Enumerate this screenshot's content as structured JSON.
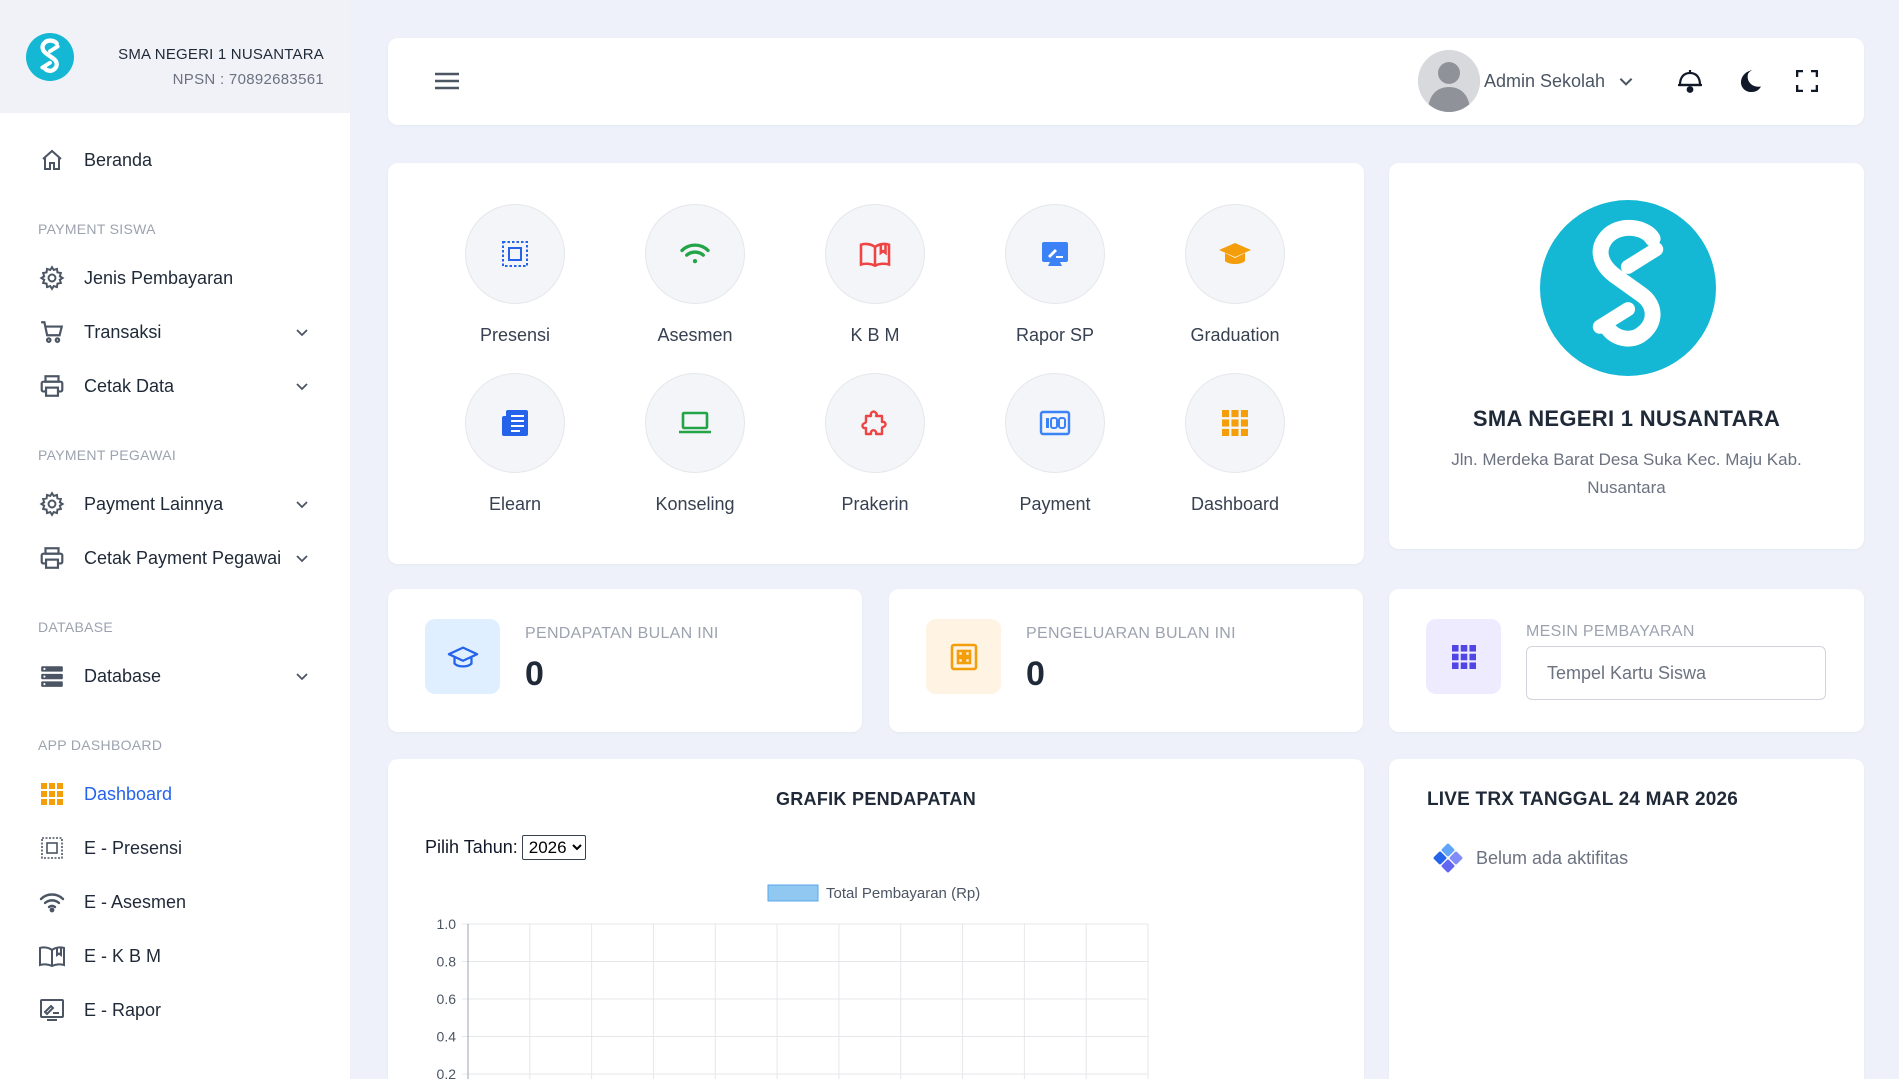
{
  "colors": {
    "accent": "#2563eb",
    "brand": "#14b8d4",
    "background": "#eef1f9",
    "orange": "#f59e0b",
    "green": "#22a447",
    "red": "#ef4444"
  },
  "sidebar": {
    "school_name": "SMA NEGERI 1 NUSANTARA",
    "npsn": "NPSN : 70892683561",
    "home": {
      "label": "Beranda",
      "icon": "home-icon"
    },
    "sections": {
      "payment_siswa": "PAYMENT SISWA",
      "payment_pegawai": "PAYMENT PEGAWAI",
      "database": "DATABASE",
      "app_dashboard": "APP DASHBOARD"
    },
    "items": {
      "jenis_pembayaran": {
        "label": "Jenis Pembayaran",
        "icon": "gear-icon"
      },
      "transaksi": {
        "label": "Transaksi",
        "icon": "cart-icon"
      },
      "cetak_data": {
        "label": "Cetak Data",
        "icon": "printer-icon"
      },
      "payment_lainnya": {
        "label": "Payment Lainnya",
        "icon": "gear-icon"
      },
      "cetak_payment_pegawai": {
        "label": "Cetak Payment Pegawai",
        "icon": "printer-icon"
      },
      "database": {
        "label": "Database",
        "icon": "server-icon"
      },
      "dashboard": {
        "label": "Dashboard",
        "icon": "grid-icon",
        "active": true
      },
      "e_presensi": {
        "label": "E - Presensi",
        "icon": "scan-icon"
      },
      "e_asesmen": {
        "label": "E - Asesmen",
        "icon": "wifi-icon"
      },
      "e_kbm": {
        "label": "E - K B M",
        "icon": "book-icon"
      },
      "e_rapor": {
        "label": "E - Rapor",
        "icon": "report-icon"
      }
    }
  },
  "topbar": {
    "user_name": "Admin Sekolah"
  },
  "apps": [
    {
      "label": "Presensi",
      "icon": "scan-icon"
    },
    {
      "label": "Asesmen",
      "icon": "wifi-icon"
    },
    {
      "label": "K B M",
      "icon": "book-icon"
    },
    {
      "label": "Rapor SP",
      "icon": "report-icon"
    },
    {
      "label": "Graduation",
      "icon": "graduation-cap-icon"
    },
    {
      "label": "Elearn",
      "icon": "newspaper-icon"
    },
    {
      "label": "Konseling",
      "icon": "laptop-icon"
    },
    {
      "label": "Prakerin",
      "icon": "puzzle-icon"
    },
    {
      "label": "Payment",
      "icon": "counter-icon"
    },
    {
      "label": "Dashboard",
      "icon": "grid-icon"
    }
  ],
  "school": {
    "name": "SMA NEGERI 1 NUSANTARA",
    "address": "Jln. Merdeka Barat Desa Suka Kec. Maju Kab. Nusantara"
  },
  "stats": {
    "pendapatan": {
      "label": "PENDAPATAN BULAN INI",
      "value": "0"
    },
    "pengeluaran": {
      "label": "PENGELUARAN BULAN INI",
      "value": "0"
    },
    "mesin": {
      "label": "MESIN PEMBAYARAN",
      "placeholder": "Tempel Kartu Siswa"
    }
  },
  "chart": {
    "title": "GRAFIK PENDAPATAN",
    "year_label": "Pilih Tahun:",
    "year_selected": "2026"
  },
  "chart_data": {
    "type": "bar",
    "title": "GRAFIK PENDAPATAN",
    "series": [
      {
        "name": "Total Pembayaran (Rp)",
        "values": []
      }
    ],
    "ylim": [
      0,
      1.0
    ],
    "yticks": [
      "1.0",
      "0.8",
      "0.6",
      "0.4",
      "0.2"
    ],
    "grid": true,
    "legend": "top"
  },
  "live": {
    "title": "LIVE TRX TANGGAL 24 MAR 2026",
    "empty_text": "Belum ada aktifitas"
  }
}
